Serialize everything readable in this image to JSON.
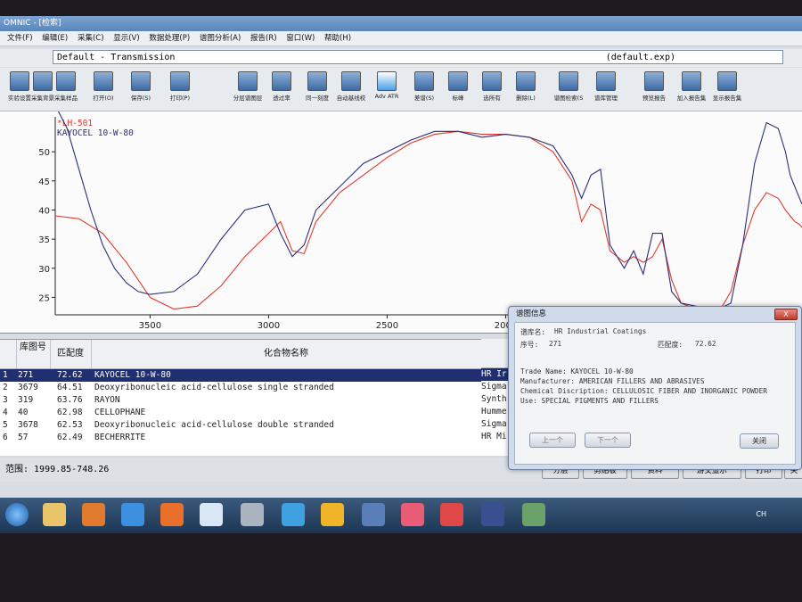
{
  "window": {
    "title": "OMNIC - [检索]"
  },
  "menu": [
    "文件(F)",
    "编辑(E)",
    "采集(C)",
    "显示(V)",
    "数据处理(P)",
    "谱图分析(A)",
    "报告(R)",
    "窗口(W)",
    "帮助(H)"
  ],
  "spectrum_bar": {
    "name": "Default - Transmission",
    "file": "(default.exp)"
  },
  "toolbar": [
    {
      "label": "实验设置",
      "icon": "experiment-setup-icon"
    },
    {
      "label": "采集背景",
      "icon": "collect-background-icon"
    },
    {
      "label": "采集样品",
      "icon": "collect-sample-icon"
    },
    {
      "label": "打开(O)",
      "icon": "open-icon"
    },
    {
      "label": "保存(S)",
      "icon": "save-icon"
    },
    {
      "label": "打印(P)",
      "icon": "print-icon"
    },
    {
      "label": "分层谱图层",
      "icon": "stack-spectra-icon"
    },
    {
      "label": "透过率",
      "icon": "transmittance-icon"
    },
    {
      "label": "同一刻度",
      "icon": "common-scale-icon"
    },
    {
      "label": "自动基线校",
      "icon": "auto-baseline-icon"
    },
    {
      "label": "Adv ATR",
      "icon": "adv-atr-icon"
    },
    {
      "label": "差谱(S)",
      "icon": "subtract-icon"
    },
    {
      "label": "标峰",
      "icon": "find-peaks-icon"
    },
    {
      "label": "选所有",
      "icon": "select-all-icon"
    },
    {
      "label": "删除(L)",
      "icon": "delete-icon"
    },
    {
      "label": "谱图检索(S",
      "icon": "spectral-search-icon"
    },
    {
      "label": "谱库管理",
      "icon": "library-manager-icon"
    },
    {
      "label": "预览报告",
      "icon": "preview-report-icon"
    },
    {
      "label": "加入报告集",
      "icon": "add-to-report-icon"
    },
    {
      "label": "显示报告集",
      "icon": "show-report-icon"
    }
  ],
  "chart_data": {
    "type": "line",
    "series": [
      {
        "name": "*LH-501",
        "color": "#e03a2f",
        "x": [
          3900,
          3800,
          3700,
          3600,
          3500,
          3400,
          3300,
          3200,
          3100,
          3000,
          2950,
          2900,
          2850,
          2800,
          2700,
          2600,
          2500,
          2400,
          2300,
          2200,
          2100,
          2000,
          1900,
          1800,
          1720,
          1680,
          1640,
          1600,
          1560,
          1500,
          1460,
          1420,
          1380,
          1340,
          1300,
          1260,
          1200,
          1150,
          1100,
          1050,
          1000,
          950,
          900,
          850,
          820,
          800,
          780,
          760,
          750
        ],
        "y": [
          39,
          38.5,
          36,
          31,
          25,
          23,
          23.5,
          27,
          32,
          36,
          38,
          33,
          32.5,
          38,
          43,
          46,
          49,
          51.5,
          53,
          53.5,
          53,
          53,
          52.5,
          50,
          45,
          38,
          41,
          40,
          33,
          31,
          32,
          31,
          32,
          35,
          28,
          24,
          23,
          22,
          22.5,
          26,
          34,
          40,
          43,
          42,
          40,
          39,
          38,
          37.5,
          37
        ]
      },
      {
        "name": "KAYOCEL 10-W-80",
        "color": "#2a2f7a",
        "x": [
          3900,
          3850,
          3800,
          3750,
          3700,
          3650,
          3600,
          3550,
          3500,
          3400,
          3300,
          3200,
          3100,
          3000,
          2950,
          2900,
          2850,
          2800,
          2700,
          2600,
          2500,
          2400,
          2300,
          2200,
          2100,
          2000,
          1900,
          1800,
          1720,
          1680,
          1640,
          1600,
          1560,
          1500,
          1460,
          1420,
          1380,
          1340,
          1300,
          1260,
          1200,
          1150,
          1100,
          1050,
          1000,
          950,
          900,
          850,
          820,
          800,
          780,
          760,
          750
        ],
        "y": [
          58,
          54,
          47,
          40,
          34,
          30,
          27.5,
          26,
          25.5,
          26,
          29,
          35,
          40,
          41,
          36,
          32,
          34,
          40,
          44,
          48,
          50,
          52,
          53.5,
          53.5,
          52.5,
          53,
          52.5,
          51,
          46,
          42,
          46,
          47,
          34,
          30,
          33,
          29,
          36,
          36,
          26,
          24,
          23.5,
          23,
          23,
          24,
          34,
          48,
          55,
          54,
          50,
          46,
          44,
          42,
          41
        ]
      }
    ],
    "xlim": [
      3900,
      750
    ],
    "ylim": [
      22,
      56
    ],
    "x_ticks": [
      3500,
      3000,
      2500,
      2000
    ],
    "y_ticks": [
      25,
      30,
      35,
      40,
      45,
      50
    ],
    "legend_position": "top-left"
  },
  "results": {
    "headers": [
      "库图号",
      "匹配度",
      "化合物名称"
    ],
    "rows": [
      {
        "idx": "1",
        "num": "271",
        "score": "72.62",
        "name": "KAYOCEL 10-W-80",
        "lib": "HR Ir"
      },
      {
        "idx": "2",
        "num": "3679",
        "score": "64.51",
        "name": "Deoxyribonucleic acid-cellulose single stranded",
        "lib": "Sigma"
      },
      {
        "idx": "3",
        "num": "319",
        "score": "63.76",
        "name": "RAYON",
        "lib": "Synth"
      },
      {
        "idx": "4",
        "num": "40",
        "score": "62.98",
        "name": "CELLOPHANE",
        "lib": "Humme"
      },
      {
        "idx": "5",
        "num": "3678",
        "score": "62.53",
        "name": "Deoxyribonucleic acid-cellulose double stranded",
        "lib": "Sigma"
      },
      {
        "idx": "6",
        "num": "57",
        "score": "62.49",
        "name": "BECHERRITE",
        "lib": "HR Mi"
      }
    ]
  },
  "status": {
    "range": "范围:  1999.85-748.26",
    "buttons": [
      "分层",
      "剪贴板",
      "资料",
      "游交显示",
      "打印",
      "关"
    ]
  },
  "dialog": {
    "title": "谱图信息",
    "close": "X",
    "library_label": "谱库名:",
    "library": "HR Industrial Coatings",
    "index_label": "序号:",
    "index": "271",
    "match_label": "匹配度:",
    "match": "72.62",
    "trade_name": "Trade Name:  KAYOCEL 10-W-80",
    "manufacturer": "Manufacturer:  AMERICAN FILLERS AND ABRASIVES",
    "chem": "Chemical Discription:  CELLULOSIC FIBER AND INORGANIC POWDER",
    "use": "Use:  SPECIAL PIGMENTS AND FILLERS",
    "prev": "上一个",
    "next": "下一个",
    "close_btn": "关闭"
  },
  "tray": {
    "lang": "CH"
  }
}
